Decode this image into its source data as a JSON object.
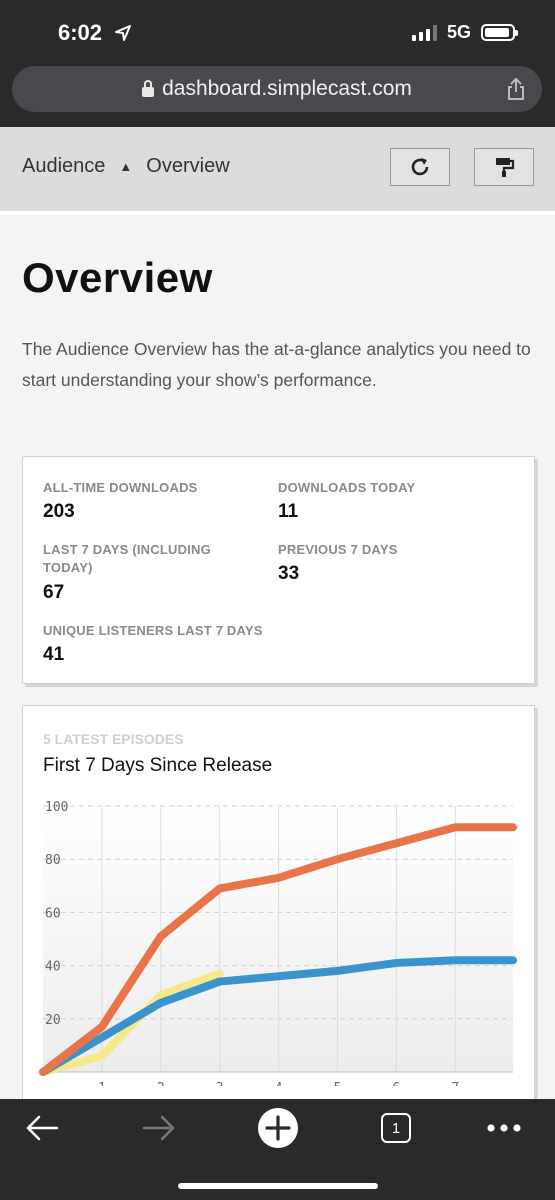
{
  "status": {
    "time": "6:02",
    "network": "5G"
  },
  "browser": {
    "url": "dashboard.simplecast.com",
    "tab_count": "1"
  },
  "breadcrumb": {
    "section": "Audience",
    "page": "Overview"
  },
  "page": {
    "title": "Overview",
    "description": "The Audience Overview has the at-a-glance analytics you need to start understanding your show’s performance."
  },
  "stats": [
    {
      "label": "ALL-TIME DOWNLOADS",
      "value": "203"
    },
    {
      "label": "DOWNLOADS TODAY",
      "value": "11"
    },
    {
      "label": "LAST 7 DAYS (INCLUDING TODAY)",
      "value": "67"
    },
    {
      "label": "PREVIOUS 7 DAYS",
      "value": "33"
    },
    {
      "label": "UNIQUE LISTENERS LAST 7 DAYS",
      "value": "41"
    }
  ],
  "episodes_card": {
    "kicker": "5 LATEST EPISODES",
    "title": "First 7 Days Since Release"
  },
  "colors": {
    "orange": "#e8744a",
    "blue": "#3a93cc",
    "yellow": "#f4e98a"
  },
  "chart_data": {
    "type": "line",
    "xlabel": "",
    "ylabel": "",
    "x_ticks": [
      1,
      2,
      3,
      4,
      5,
      6,
      7
    ],
    "y_ticks": [
      20,
      40,
      60,
      80,
      100
    ],
    "xlim": [
      0,
      7.98
    ],
    "ylim": [
      0,
      100
    ],
    "grid": true,
    "legend": "none",
    "series": [
      {
        "color": "#e8744a",
        "x": [
          0,
          1,
          2,
          3,
          4,
          5,
          6,
          7,
          7.98
        ],
        "y": [
          0,
          17,
          51,
          69,
          73,
          80,
          86,
          92,
          92
        ]
      },
      {
        "color": "#3a93cc",
        "x": [
          0,
          1,
          2,
          3,
          4,
          5,
          6,
          7,
          7.98
        ],
        "y": [
          0,
          13,
          26,
          34,
          36,
          38,
          41,
          42,
          42
        ]
      },
      {
        "color": "#f4e98a",
        "x": [
          0,
          1,
          2,
          3
        ],
        "y": [
          0,
          6,
          29,
          37
        ]
      }
    ]
  }
}
